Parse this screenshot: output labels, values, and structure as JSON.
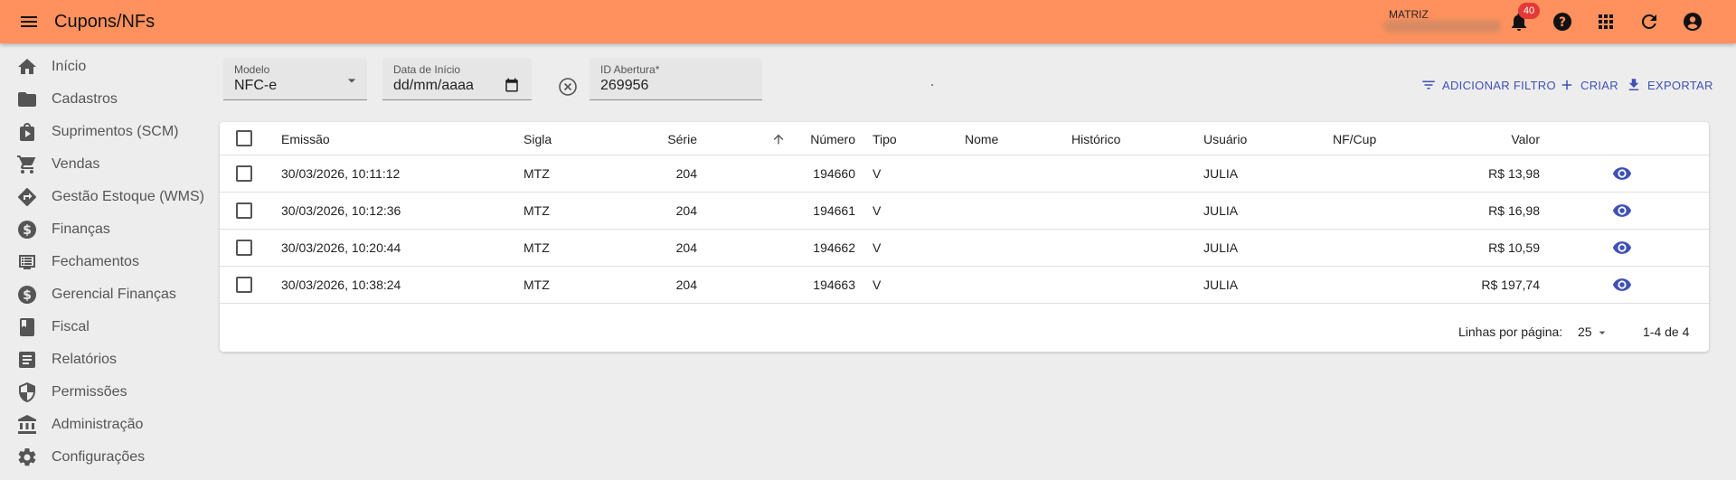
{
  "app": {
    "title": "Cupons/NFs",
    "company": "MATRIZ",
    "notifications_count": "40"
  },
  "sidebar": {
    "items": [
      {
        "label": "Início",
        "icon": "home-icon"
      },
      {
        "label": "Cadastros",
        "icon": "folder-icon"
      },
      {
        "label": "Suprimentos (SCM)",
        "icon": "shopping-bag-icon"
      },
      {
        "label": "Vendas",
        "icon": "cart-icon"
      },
      {
        "label": "Gestão Estoque (WMS)",
        "icon": "directions-icon"
      },
      {
        "label": "Finanças",
        "icon": "dollar-circle-icon"
      },
      {
        "label": "Fechamentos",
        "icon": "list-alt-icon"
      },
      {
        "label": "Gerencial Finanças",
        "icon": "dollar-circle-icon"
      },
      {
        "label": "Fiscal",
        "icon": "book-icon"
      },
      {
        "label": "Relatórios",
        "icon": "report-icon"
      },
      {
        "label": "Permissões",
        "icon": "shield-icon"
      },
      {
        "label": "Administração",
        "icon": "bank-icon"
      },
      {
        "label": "Configurações",
        "icon": "gear-icon"
      }
    ]
  },
  "filters": {
    "modelo": {
      "label": "Modelo",
      "value": "NFC-e"
    },
    "data_inicio": {
      "label": "Data de Início",
      "value": "dd/mm/aaaa"
    },
    "id_abertura": {
      "label": "ID Abertura*",
      "value": "269956"
    }
  },
  "actions": {
    "add_filter": "ADICIONAR FILTRO",
    "create": "CRIAR",
    "export": "EXPORTAR"
  },
  "table": {
    "headers": {
      "emissao": "Emissão",
      "sigla": "Sigla",
      "serie": "Série",
      "numero": "Número",
      "tipo": "Tipo",
      "nome": "Nome",
      "historico": "Histórico",
      "usuario": "Usuário",
      "nfcup": "NF/Cup",
      "valor": "Valor"
    },
    "rows": [
      {
        "emissao": "30/03/2026, 10:11:12",
        "sigla": "MTZ",
        "serie": "204",
        "numero": "194660",
        "tipo": "V",
        "nome": "",
        "historico": "",
        "usuario": "JULIA",
        "nfcup": "",
        "valor": "R$ 13,98"
      },
      {
        "emissao": "30/03/2026, 10:12:36",
        "sigla": "MTZ",
        "serie": "204",
        "numero": "194661",
        "tipo": "V",
        "nome": "",
        "historico": "",
        "usuario": "JULIA",
        "nfcup": "",
        "valor": "R$ 16,98"
      },
      {
        "emissao": "30/03/2026, 10:20:44",
        "sigla": "MTZ",
        "serie": "204",
        "numero": "194662",
        "tipo": "V",
        "nome": "",
        "historico": "",
        "usuario": "JULIA",
        "nfcup": "",
        "valor": "R$ 10,59"
      },
      {
        "emissao": "30/03/2026, 10:38:24",
        "sigla": "MTZ",
        "serie": "204",
        "numero": "194663",
        "tipo": "V",
        "nome": "",
        "historico": "",
        "usuario": "JULIA",
        "nfcup": "",
        "valor": "R$ 197,74"
      }
    ],
    "pagination": {
      "rows_per_page_label": "Linhas por página:",
      "rows_per_page": "25",
      "range": "1-4 de 4"
    }
  },
  "colors": {
    "appbar": "#fe915e",
    "accent": "#3f51b5",
    "badge": "#e53935"
  }
}
